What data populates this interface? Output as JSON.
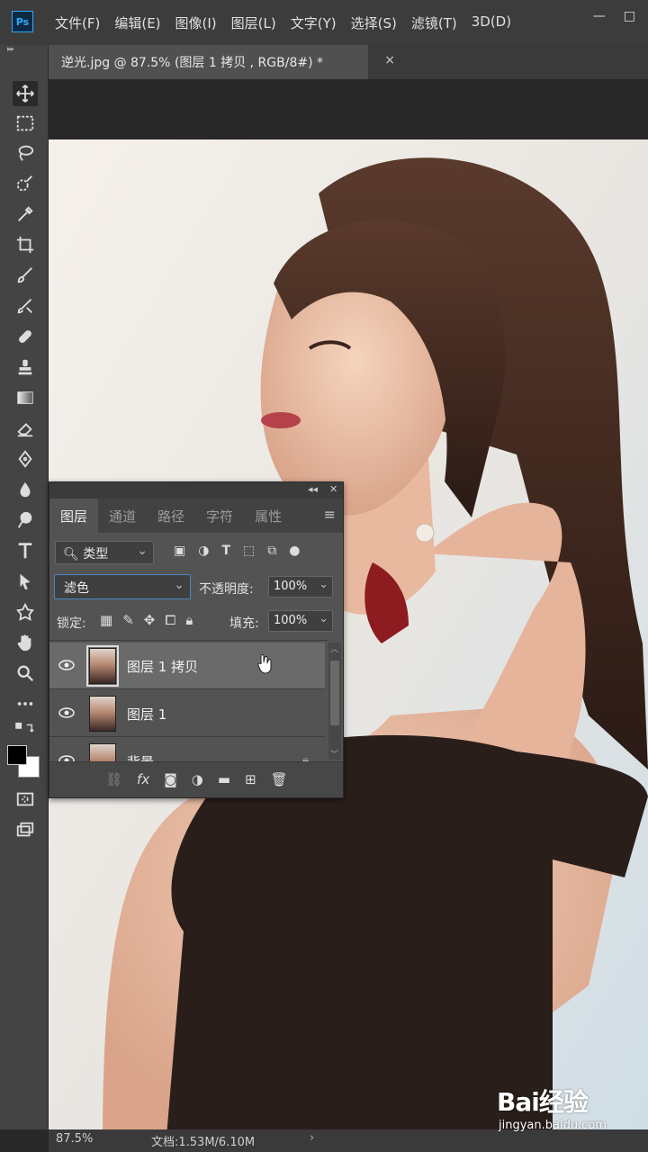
{
  "app": {
    "logo": "Ps"
  },
  "menu": [
    "文件(F)",
    "编辑(E)",
    "图像(I)",
    "图层(L)",
    "文字(Y)",
    "选择(S)",
    "滤镜(T)",
    "3D(D)"
  ],
  "window_controls": {
    "minimize": "—",
    "restore": "□"
  },
  "toolbar": {
    "collapse": "▸▸",
    "tools": [
      "move-icon",
      "marquee-icon",
      "lasso-icon",
      "quick-select-icon",
      "eyedropper-icon",
      "crop-icon",
      "brush-icon",
      "healing-icon",
      "clone-stamp-icon",
      "eraser-icon",
      "gradient-icon",
      "pen-icon",
      "blur-icon",
      "dodge-icon",
      "type-icon",
      "path-select-icon",
      "shape-icon",
      "hand-icon",
      "zoom-icon",
      "more-icon",
      "swap-colors-icon",
      "foreground-color",
      "quick-mask-icon",
      "screen-mode-icon"
    ]
  },
  "document": {
    "tab_title": "逆光.jpg @ 87.5% (图层 1 拷贝 , RGB/8#) *",
    "close": "×"
  },
  "status": {
    "zoom": "87.5%",
    "doc": "文档:1.53M/6.10M",
    "arrow": "›"
  },
  "panel": {
    "collapse": "◂◂",
    "close": "✕",
    "tabs": [
      "图层",
      "通道",
      "路径",
      "字符",
      "属性"
    ],
    "menu": "≡",
    "kind_filter": "类型",
    "blend_mode": "滤色",
    "opacity_label": "不透明度:",
    "opacity": "100%",
    "lock_label": "锁定:",
    "fill_label": "填充:",
    "fill": "100%",
    "layers": [
      {
        "name": "图层 1 拷贝",
        "selected": true
      },
      {
        "name": "图层 1",
        "selected": false
      },
      {
        "name": "背景",
        "selected": false,
        "locked": true
      }
    ]
  },
  "watermark": {
    "logo": "Bai经验",
    "url": "jingyan.baidu.com"
  },
  "colors": {
    "app_bg": "#282828",
    "panel_bg": "#535353",
    "selected_layer": "#6a6a6a",
    "accent": "#31a8ff"
  }
}
